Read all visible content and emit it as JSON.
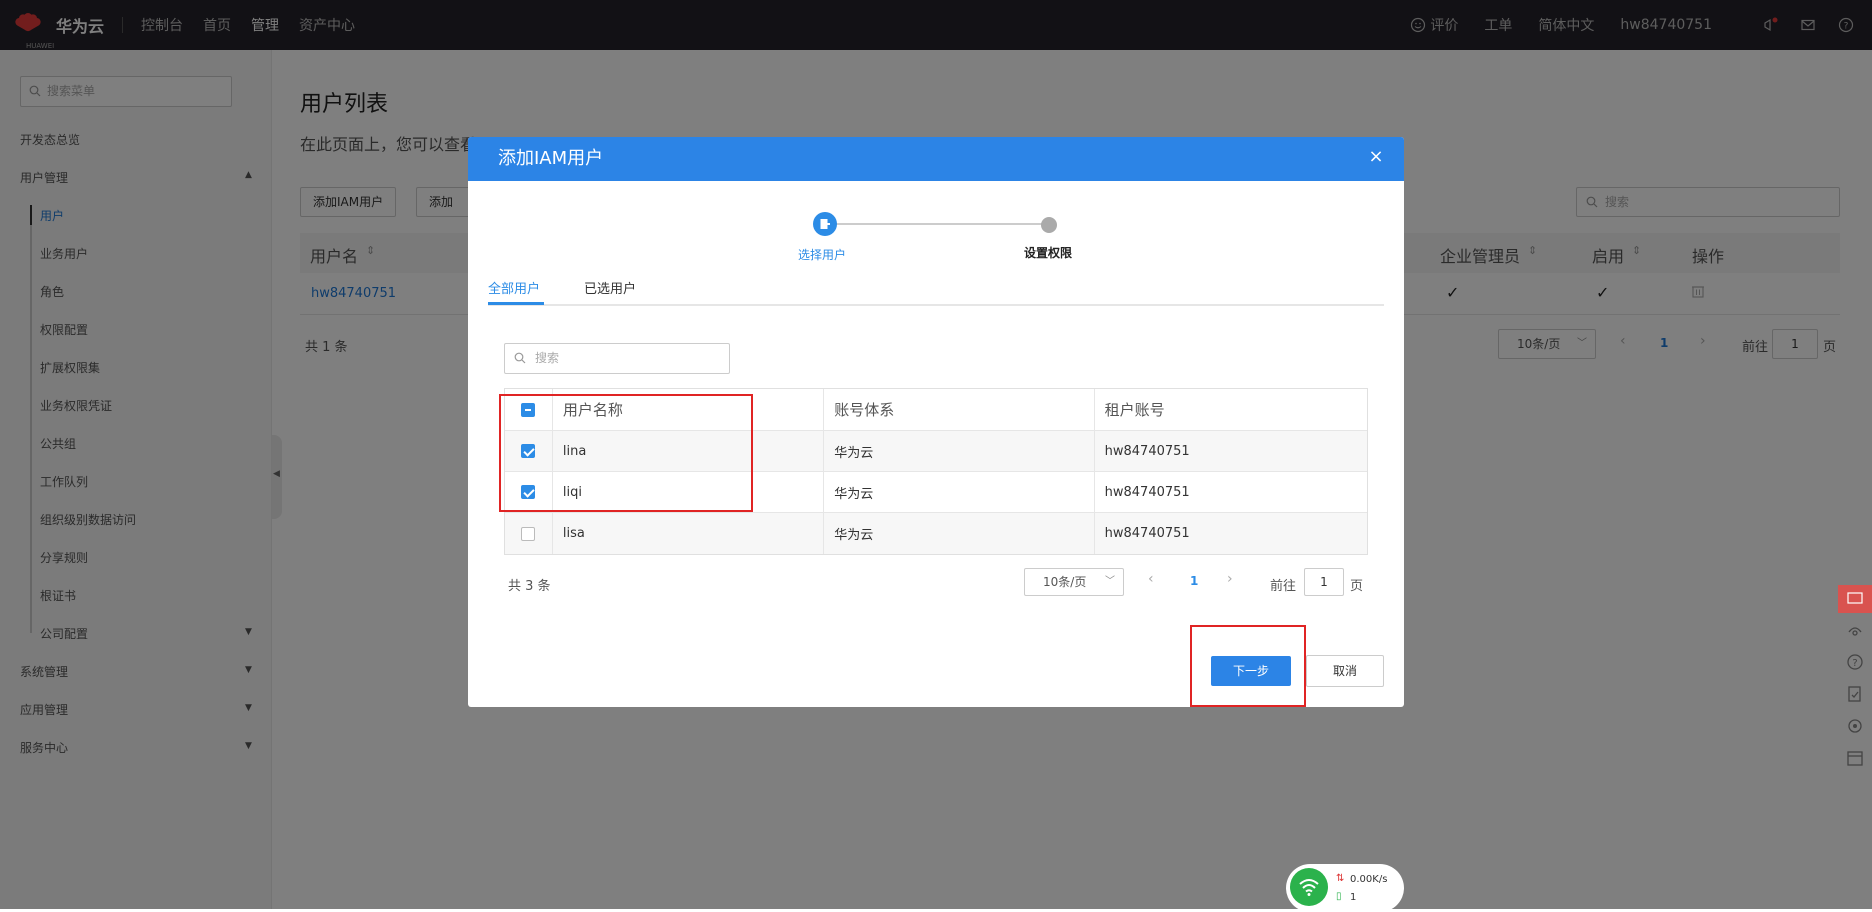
{
  "topbar": {
    "logo_text": "HUAWEI",
    "brand": "华为云",
    "nav": [
      "控制台",
      "首页",
      "管理",
      "资产中心"
    ],
    "right": {
      "rate": "评价",
      "ticket": "工单",
      "language": "简体中文",
      "account": "hw84740751"
    }
  },
  "sidebar": {
    "search_placeholder": "搜索菜单",
    "items": [
      {
        "label": "开发态总览"
      },
      {
        "label": "用户管理"
      },
      {
        "label": "用户"
      },
      {
        "label": "业务用户"
      },
      {
        "label": "角色"
      },
      {
        "label": "权限配置"
      },
      {
        "label": "扩展权限集"
      },
      {
        "label": "业务权限凭证"
      },
      {
        "label": "公共组"
      },
      {
        "label": "工作队列"
      },
      {
        "label": "组织级别数据访问"
      },
      {
        "label": "分享规则"
      },
      {
        "label": "根证书"
      },
      {
        "label": "公司配置"
      },
      {
        "label": "系统管理"
      },
      {
        "label": "应用管理"
      },
      {
        "label": "服务中心"
      }
    ]
  },
  "background": {
    "title": "用户列表",
    "desc": "在此页面上，您可以查看",
    "btn_add_iam": "添加IAM用户",
    "btn_add_w": "添加W",
    "search_placeholder": "搜索",
    "columns": {
      "username": "用户名",
      "enterprise_admin": "企业管理员",
      "enabled": "启用",
      "actions": "操作"
    },
    "row": {
      "username": "hw84740751",
      "enterprise_admin": "✓",
      "enabled": "✓"
    },
    "total": "共 1 条",
    "page_size": "10条/页",
    "page": "1",
    "goto": "前往",
    "goto_value": "1",
    "page_unit": "页"
  },
  "modal": {
    "title": "添加IAM用户",
    "close": "×",
    "steps": [
      "选择用户",
      "设置权限"
    ],
    "tabs": [
      "全部用户",
      "已选用户"
    ],
    "search_placeholder": "搜索",
    "columns": [
      "用户名称",
      "账号体系",
      "租户账号"
    ],
    "rows": [
      {
        "name": "lina",
        "system": "华为云",
        "tenant": "hw84740751",
        "checked": true
      },
      {
        "name": "liqi",
        "system": "华为云",
        "tenant": "hw84740751",
        "checked": true
      },
      {
        "name": "lisa",
        "system": "华为云",
        "tenant": "hw84740751",
        "checked": false
      }
    ],
    "total": "共 3 条",
    "page_size": "10条/页",
    "page": "1",
    "goto": "前往",
    "goto_value": "1",
    "page_unit": "页",
    "next_button": "下一步",
    "cancel_button": "取消"
  },
  "net_widget": {
    "speed": "0.00K/s",
    "count": "1"
  },
  "colors": {
    "topbar_bg": "#25222a",
    "primary": "#2c84e6",
    "highlight": "#e02424",
    "huawei_red": "#e43b3b"
  }
}
